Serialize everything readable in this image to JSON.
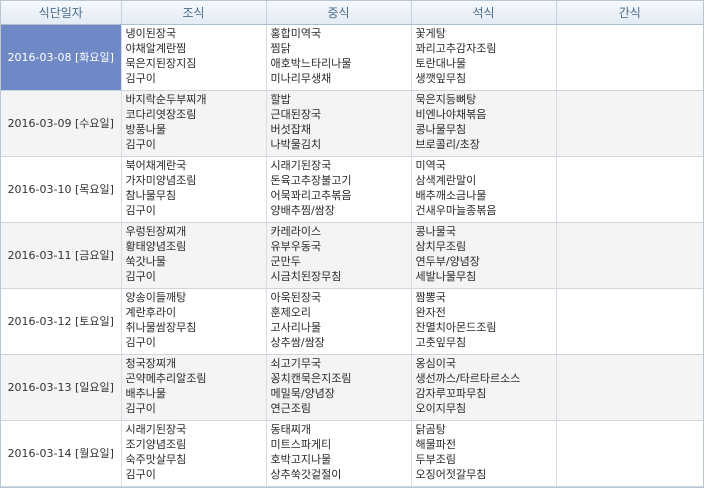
{
  "headers": [
    "식단일자",
    "조식",
    "중식",
    "석식",
    "간식"
  ],
  "rows": [
    {
      "date": "2016-03-08 [화요일]",
      "selected": true,
      "breakfast": [
        "냉이된장국",
        "야채알계란찜",
        "묵은지된장지짐",
        "김구이"
      ],
      "lunch": [
        "홍합미역국",
        "찜닭",
        "애호박느타리나물",
        "미나리무생채"
      ],
      "dinner": [
        "꽃게탕",
        "꽈리고추감자조림",
        "토란대나물",
        "생깻잎무침"
      ],
      "snack": []
    },
    {
      "date": "2016-03-09 [수요일]",
      "selected": false,
      "breakfast": [
        "바지락순두부찌개",
        "코다리엿장조림",
        "방풍나물",
        "김구이"
      ],
      "lunch": [
        "할밥",
        "근대된장국",
        "버섯잡채",
        "나박물김치"
      ],
      "dinner": [
        "묵은지등뼈탕",
        "비엔나야채볶음",
        "콩나물무침",
        "브로콜리/초장"
      ],
      "snack": []
    },
    {
      "date": "2016-03-10 [목요일]",
      "selected": false,
      "breakfast": [
        "북어채계란국",
        "가자미양념조림",
        "참나물무침",
        "김구이"
      ],
      "lunch": [
        "시래기된장국",
        "돈육고추장불고기",
        "어묵꽈리고추볶음",
        "양배추찜/쌈장"
      ],
      "dinner": [
        "미역국",
        "삼색계란말이",
        "배추깨소금나물",
        "건새우마늘종볶음"
      ],
      "snack": []
    },
    {
      "date": "2016-03-11 [금요일]",
      "selected": false,
      "breakfast": [
        "우렁된장찌개",
        "황태양념조림",
        "쑥갓나물",
        "김구이"
      ],
      "lunch": [
        "카레라이스",
        "유부우동국",
        "군만두",
        "시금치된장무침"
      ],
      "dinner": [
        "콩나물국",
        "삼치무조림",
        "연두부/양념장",
        "세발나물무침"
      ],
      "snack": []
    },
    {
      "date": "2016-03-12 [토요일]",
      "selected": false,
      "breakfast": [
        "양송이들깨탕",
        "계란후라이",
        "취나물쌈장무침",
        "김구이"
      ],
      "lunch": [
        "아욱된장국",
        "훈제오리",
        "고사리나물",
        "상추쌈/쌈장"
      ],
      "dinner": [
        "짬뽕국",
        "완자전",
        "잔멸치아몬드조림",
        "고춧잎무침"
      ],
      "snack": []
    },
    {
      "date": "2016-03-13 [일요일]",
      "selected": false,
      "breakfast": [
        "청국장찌개",
        "곤약메추리알조림",
        "배추나물",
        "김구이"
      ],
      "lunch": [
        "쇠고기무국",
        "꽁치캔묵은지조림",
        "메밀묵/양념장",
        "연근조림"
      ],
      "dinner": [
        "옹심이국",
        "생선까스/타르타르소스",
        "감자루꼬파무침",
        "오이지무침"
      ],
      "snack": []
    },
    {
      "date": "2016-03-14 [월요일]",
      "selected": false,
      "breakfast": [
        "시래기된장국",
        "조기양념조림",
        "숙주맛살무침",
        "김구이"
      ],
      "lunch": [
        "동태찌개",
        "미트스파게티",
        "호박고지나물",
        "상추쑥갓겉절이"
      ],
      "dinner": [
        "닭곰탕",
        "해물파전",
        "두부조림",
        "오징어젓갈무침"
      ],
      "snack": []
    }
  ]
}
